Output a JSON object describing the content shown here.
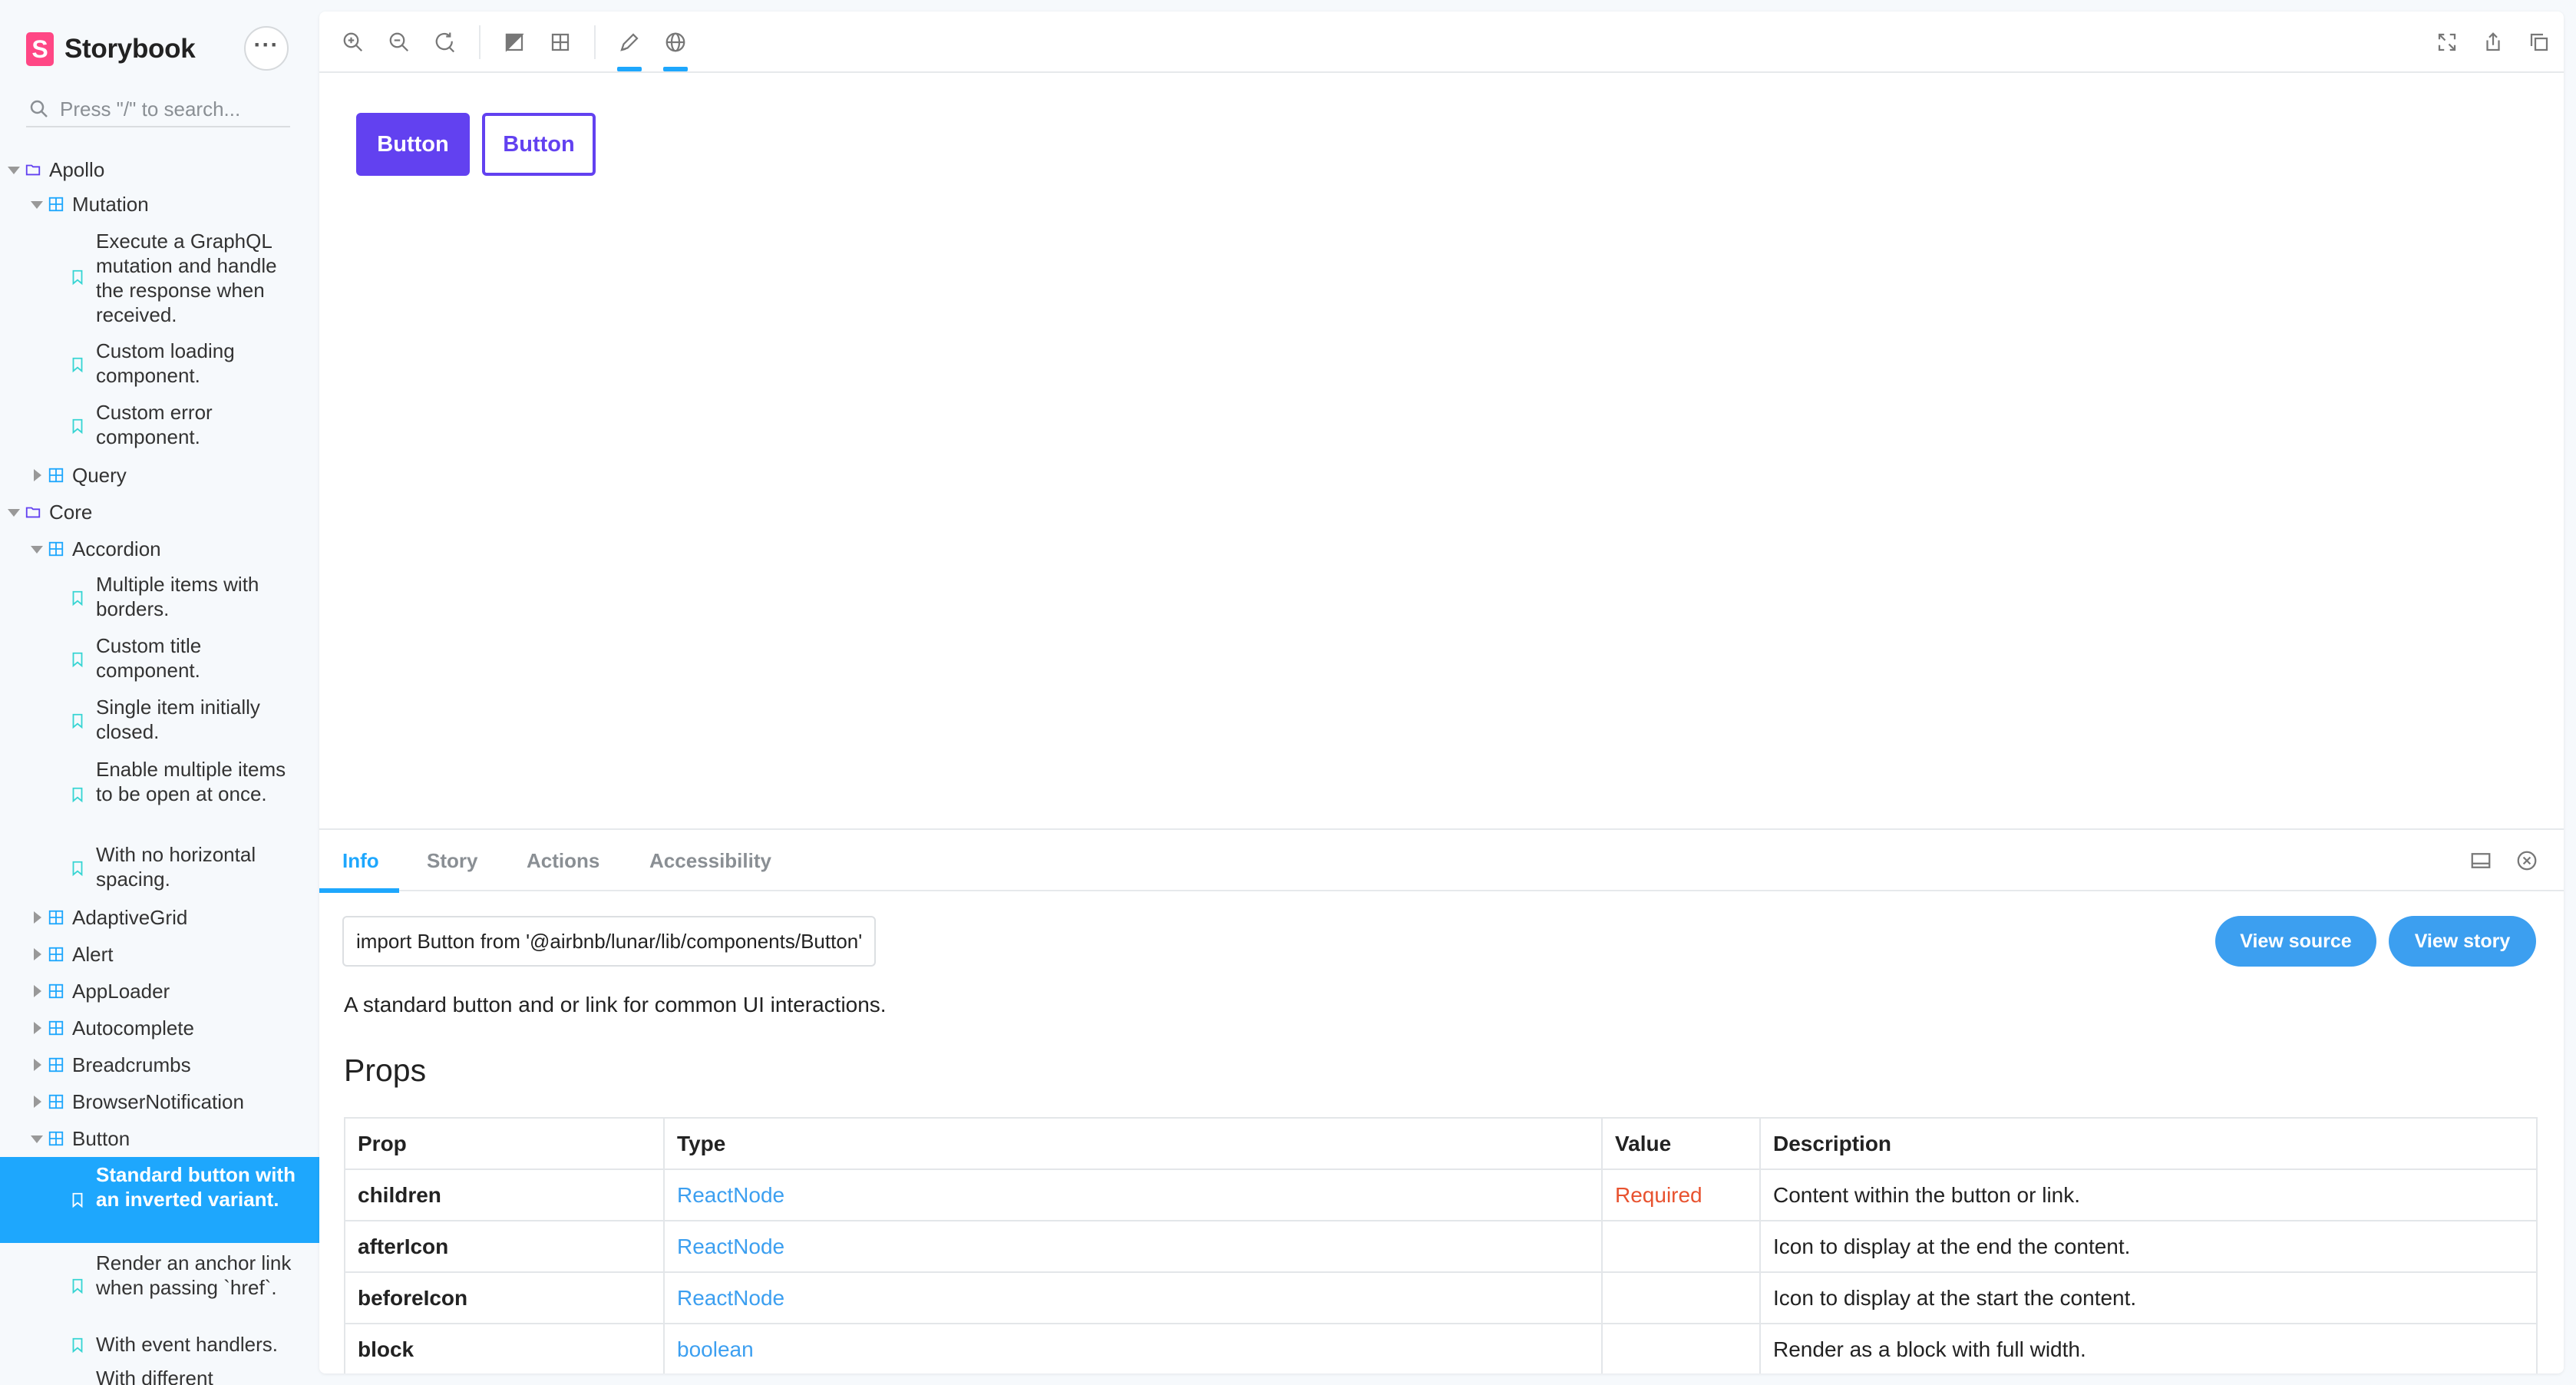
{
  "brand": {
    "name": "Storybook",
    "logo_letter": "S",
    "color": "#ff4785"
  },
  "search": {
    "placeholder": "Press \"/\" to search..."
  },
  "sidebar": {
    "tree": [
      {
        "kind": "group",
        "label": "Apollo",
        "expanded": true
      },
      {
        "kind": "component",
        "label": "Mutation",
        "expanded": true
      },
      {
        "kind": "story",
        "label": "Execute a GraphQL mutation and handle the response when received."
      },
      {
        "kind": "story",
        "label": "Custom loading component."
      },
      {
        "kind": "story",
        "label": "Custom error component."
      },
      {
        "kind": "component",
        "label": "Query",
        "expanded": false
      },
      {
        "kind": "group",
        "label": "Core",
        "expanded": true
      },
      {
        "kind": "component",
        "label": "Accordion",
        "expanded": true
      },
      {
        "kind": "story",
        "label": "Multiple items with borders."
      },
      {
        "kind": "story",
        "label": "Custom title component."
      },
      {
        "kind": "story",
        "label": "Single item initially closed."
      },
      {
        "kind": "story",
        "label": "Enable multiple items to be open at once."
      },
      {
        "kind": "story",
        "label": "With no horizontal spacing."
      },
      {
        "kind": "component",
        "label": "AdaptiveGrid",
        "expanded": false
      },
      {
        "kind": "component",
        "label": "Alert",
        "expanded": false
      },
      {
        "kind": "component",
        "label": "AppLoader",
        "expanded": false
      },
      {
        "kind": "component",
        "label": "Autocomplete",
        "expanded": false
      },
      {
        "kind": "component",
        "label": "Breadcrumbs",
        "expanded": false
      },
      {
        "kind": "component",
        "label": "BrowserNotification",
        "expanded": false
      },
      {
        "kind": "component",
        "label": "Button",
        "expanded": true
      },
      {
        "kind": "story",
        "label": "Standard button with an inverted variant.",
        "active": true
      },
      {
        "kind": "story",
        "label": "Render an anchor link when passing `href`."
      },
      {
        "kind": "story",
        "label": "With event handlers."
      },
      {
        "kind": "story",
        "label": "With different"
      }
    ]
  },
  "toolbar": {
    "left_icons": [
      "zoom-in-icon",
      "zoom-out-icon",
      "zoom-reset-icon",
      "background-icon",
      "grid-icon",
      "pencil-icon",
      "globe-icon"
    ],
    "right_icons": [
      "fullscreen-icon",
      "share-icon",
      "copy-link-icon"
    ],
    "active_tab_icons": [
      "pencil-icon",
      "globe-icon"
    ]
  },
  "preview": {
    "primary_button_label": "Button",
    "inverted_button_label": "Button",
    "button_color": "#6241f0"
  },
  "panel": {
    "tabs": [
      {
        "label": "Info",
        "active": true
      },
      {
        "label": "Story"
      },
      {
        "label": "Actions"
      },
      {
        "label": "Accessibility"
      }
    ],
    "import_statement": "import Button from '@airbnb/lunar/lib/components/Button'",
    "view_source_label": "View source",
    "view_story_label": "View story",
    "description": "A standard button and or link for common UI interactions.",
    "props_title": "Props",
    "props_headers": [
      "Prop",
      "Type",
      "Value",
      "Description"
    ],
    "props_rows": [
      {
        "prop": "children",
        "type": "ReactNode",
        "value": "Required",
        "description": "Content within the button or link."
      },
      {
        "prop": "afterIcon",
        "type": "ReactNode",
        "value": "",
        "description": "Icon to display at the end the content."
      },
      {
        "prop": "beforeIcon",
        "type": "ReactNode",
        "value": "",
        "description": "Icon to display at the start the content."
      },
      {
        "prop": "block",
        "type": "boolean",
        "value": "",
        "description": "Render as a block with full width."
      }
    ],
    "accent_color": "#1ea7fd",
    "link_color": "#3c9ff0",
    "required_color": "#e8522f"
  }
}
